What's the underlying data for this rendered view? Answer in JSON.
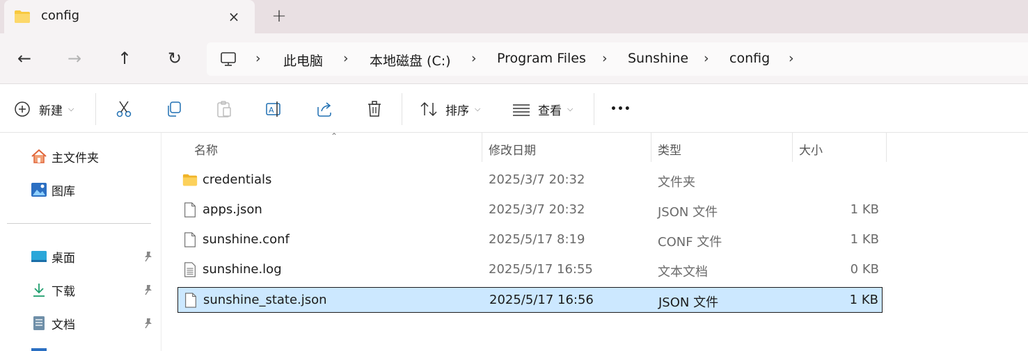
{
  "tab": {
    "title": "config",
    "close_icon": "×",
    "new_tab_icon": "+"
  },
  "nav": {
    "back_icon": "←",
    "forward_icon": "→",
    "up_icon": "↑",
    "refresh_icon": "↻"
  },
  "breadcrumb": {
    "separator": "›",
    "items": [
      "此电脑",
      "本地磁盘 (C:)",
      "Program Files",
      "Sunshine",
      "config"
    ]
  },
  "commands": {
    "new_label": "新建",
    "sort_label": "排序",
    "view_label": "查看",
    "more_icon": "•••",
    "chevron": "⌵"
  },
  "sidebar": {
    "items": [
      {
        "label": "主文件夹",
        "icon": "home-icon"
      },
      {
        "label": "图库",
        "icon": "gallery-icon"
      }
    ],
    "pinned": [
      {
        "label": "桌面",
        "icon": "desktop-icon"
      },
      {
        "label": "下载",
        "icon": "download-icon"
      },
      {
        "label": "文档",
        "icon": "documents-icon"
      }
    ]
  },
  "columns": {
    "name": "名称",
    "date": "修改日期",
    "type": "类型",
    "size": "大小",
    "sort_indicator": "⌃"
  },
  "files": [
    {
      "name": "credentials",
      "date": "2025/3/7 20:32",
      "type": "文件夹",
      "size": "",
      "icon": "folder-icon"
    },
    {
      "name": "apps.json",
      "date": "2025/3/7 20:32",
      "type": "JSON 文件",
      "size": "1 KB",
      "icon": "file-icon"
    },
    {
      "name": "sunshine.conf",
      "date": "2025/5/17 8:19",
      "type": "CONF 文件",
      "size": "1 KB",
      "icon": "file-icon"
    },
    {
      "name": "sunshine.log",
      "date": "2025/5/17 16:55",
      "type": "文本文档",
      "size": "0 KB",
      "icon": "text-file-icon"
    },
    {
      "name": "sunshine_state.json",
      "date": "2025/5/17 16:56",
      "type": "JSON 文件",
      "size": "1 KB",
      "icon": "file-icon",
      "selected": true
    }
  ],
  "colors": {
    "selection_bg": "#cce8ff",
    "folder_yellow": "#f8c93f",
    "tabstrip_bg": "#e9e0e3"
  }
}
